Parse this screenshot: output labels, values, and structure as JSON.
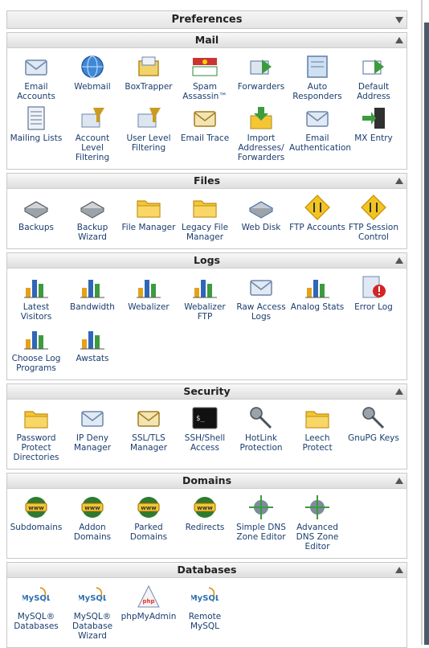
{
  "preferences": {
    "title": "Preferences"
  },
  "sections": {
    "mail": {
      "title": "Mail",
      "items": [
        {
          "label": "Email Accounts",
          "icon": "envelope-icon"
        },
        {
          "label": "Webmail",
          "icon": "globe-mail-icon"
        },
        {
          "label": "BoxTrapper",
          "icon": "boxtrapper-icon"
        },
        {
          "label": "Spam Assassin™",
          "icon": "spamassassin-icon"
        },
        {
          "label": "Forwarders",
          "icon": "forward-mail-icon"
        },
        {
          "label": "Auto Responders",
          "icon": "auto-responder-icon"
        },
        {
          "label": "Default Address",
          "icon": "default-address-icon"
        },
        {
          "label": "Mailing Lists",
          "icon": "mailing-list-icon"
        },
        {
          "label": "Account Level Filtering",
          "icon": "account-filter-icon"
        },
        {
          "label": "User Level Filtering",
          "icon": "user-filter-icon"
        },
        {
          "label": "Email Trace",
          "icon": "email-trace-icon"
        },
        {
          "label": "Import Addresses/ Forwarders",
          "icon": "import-icon"
        },
        {
          "label": "Email Authentication",
          "icon": "email-auth-icon"
        },
        {
          "label": "MX Entry",
          "icon": "mx-entry-icon"
        }
      ]
    },
    "files": {
      "title": "Files",
      "items": [
        {
          "label": "Backups",
          "icon": "backup-drive-icon"
        },
        {
          "label": "Backup Wizard",
          "icon": "backup-wizard-icon"
        },
        {
          "label": "File Manager",
          "icon": "folder-icon"
        },
        {
          "label": "Legacy File Manager",
          "icon": "legacy-folder-icon"
        },
        {
          "label": "Web Disk",
          "icon": "web-disk-icon"
        },
        {
          "label": "FTP Accounts",
          "icon": "ftp-accounts-icon"
        },
        {
          "label": "FTP Session Control",
          "icon": "ftp-session-icon"
        }
      ]
    },
    "logs": {
      "title": "Logs",
      "items": [
        {
          "label": "Latest Visitors",
          "icon": "latest-visitors-icon"
        },
        {
          "label": "Bandwidth",
          "icon": "bandwidth-icon"
        },
        {
          "label": "Webalizer",
          "icon": "webalizer-icon"
        },
        {
          "label": "Webalizer FTP",
          "icon": "webalizer-ftp-icon"
        },
        {
          "label": "Raw Access Logs",
          "icon": "raw-logs-icon"
        },
        {
          "label": "Analog Stats",
          "icon": "analog-stats-icon"
        },
        {
          "label": "Error Log",
          "icon": "error-log-icon"
        },
        {
          "label": "Choose Log Programs",
          "icon": "choose-log-icon"
        },
        {
          "label": "Awstats",
          "icon": "awstats-icon"
        }
      ]
    },
    "security": {
      "title": "Security",
      "items": [
        {
          "label": "Password Protect Directories",
          "icon": "locked-folder-icon"
        },
        {
          "label": "IP Deny Manager",
          "icon": "ip-deny-icon"
        },
        {
          "label": "SSL/TLS Manager",
          "icon": "ssl-icon"
        },
        {
          "label": "SSH/Shell Access",
          "icon": "terminal-icon"
        },
        {
          "label": "HotLink Protection",
          "icon": "hotlink-icon"
        },
        {
          "label": "Leech Protect",
          "icon": "leech-icon"
        },
        {
          "label": "GnuPG Keys",
          "icon": "keys-icon"
        }
      ]
    },
    "domains": {
      "title": "Domains",
      "items": [
        {
          "label": "Subdomains",
          "icon": "subdomains-icon"
        },
        {
          "label": "Addon Domains",
          "icon": "addon-domain-icon"
        },
        {
          "label": "Parked Domains",
          "icon": "parked-domain-icon"
        },
        {
          "label": "Redirects",
          "icon": "redirect-icon"
        },
        {
          "label": "Simple DNS Zone Editor",
          "icon": "simple-dns-icon"
        },
        {
          "label": "Advanced DNS Zone Editor",
          "icon": "advanced-dns-icon"
        }
      ]
    },
    "databases": {
      "title": "Databases",
      "items": [
        {
          "label": "MySQL® Databases",
          "icon": "mysql-icon"
        },
        {
          "label": "MySQL® Database Wizard",
          "icon": "mysql-wizard-icon"
        },
        {
          "label": "phpMyAdmin",
          "icon": "phpmyadmin-icon"
        },
        {
          "label": "Remote MySQL",
          "icon": "remote-mysql-icon"
        }
      ]
    }
  }
}
